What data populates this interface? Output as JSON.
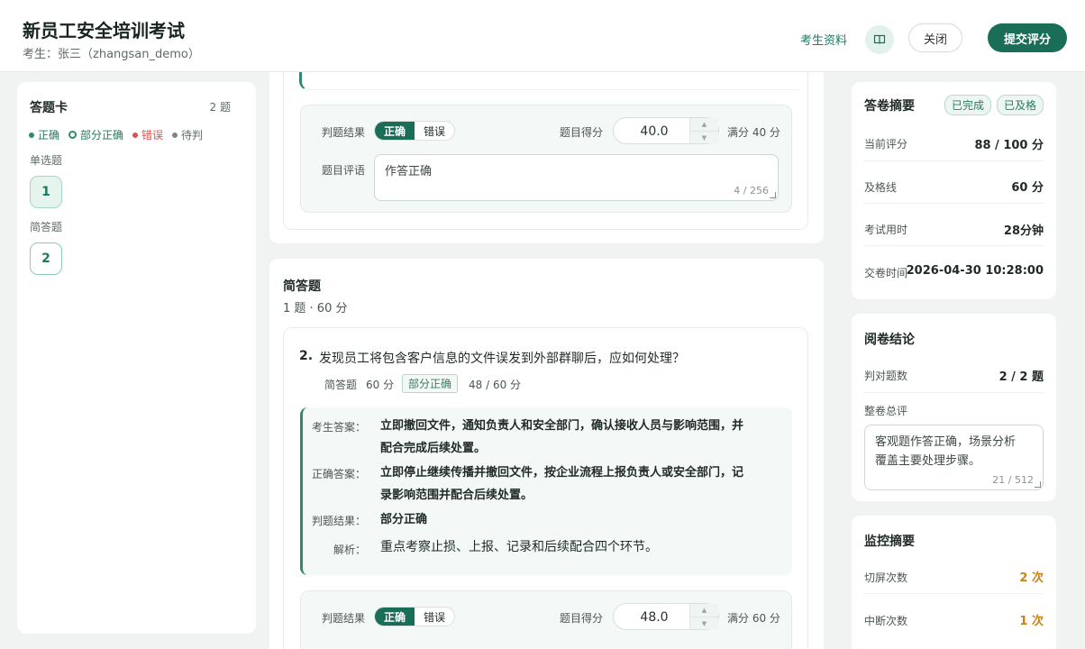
{
  "header": {
    "title": "新员工安全培训考试",
    "subtitle": "考生：张三（zhangsan_demo）",
    "profile_link": "考生资料",
    "close_label": "关闭",
    "submit_label": "提交评分"
  },
  "answer_card": {
    "title": "答题卡",
    "count": "2 题",
    "legend": {
      "correct": "正确",
      "partial": "部分正确",
      "wrong": "错误",
      "pending": "待判"
    },
    "sections": [
      {
        "label": "单选题",
        "questions": [
          "1"
        ]
      },
      {
        "label": "简答题",
        "questions": [
          "2"
        ]
      }
    ]
  },
  "q1_grading": {
    "result_label": "判题结果",
    "correct_label": "正确",
    "wrong_label": "错误",
    "score_label": "题目得分",
    "score_value": "40.0",
    "full_score": "满分 40 分",
    "comment_label": "题目评语",
    "comment": "作答正确",
    "comment_count": "4 / 256"
  },
  "section_short": {
    "title": "简答题",
    "summary": "1 题 · 60 分"
  },
  "q2": {
    "number": "2.",
    "text": "发现员工将包含客户信息的文件误发到外部群聊后，应如何处理？",
    "type": "简答题",
    "points": "60 分",
    "status_badge": "部分正确",
    "score": "48 / 60 分",
    "student_answer_label": "考生答案：",
    "student_answer_line1": "立即撤回文件，通知负责人和安全部门，确认接收人员与影响范围，并",
    "student_answer_line2": "配合完成后续处置。",
    "correct_answer_label": "正确答案：",
    "correct_answer_line1": "立即停止继续传播并撤回文件，按企业流程上报负责人或安全部门，记",
    "correct_answer_line2": "录影响范围并配合后续处置。",
    "result_label": "判题结果：",
    "result_value": "部分正确",
    "analysis_label": "解析：",
    "analysis": "重点考察止损、上报、记录和后续配合四个环节。"
  },
  "q2_grading": {
    "result_label": "判题结果",
    "correct_label": "正确",
    "wrong_label": "错误",
    "score_label": "题目得分",
    "score_value": "48.0",
    "full_score": "满分 60 分"
  },
  "summary": {
    "title": "答卷摘要",
    "badge_done": "已完成",
    "badge_pass": "已及格",
    "rows": [
      {
        "k": "当前评分",
        "v": "88 / 100 分"
      },
      {
        "k": "及格线",
        "v": "60 分"
      },
      {
        "k": "考试用时",
        "v": "28分钟"
      },
      {
        "k": "交卷时间",
        "v": "2026-04-30 10:28:00"
      }
    ]
  },
  "conclusion": {
    "title": "阅卷结论",
    "correct_k": "判对题数",
    "correct_v": "2 / 2 题",
    "overall_label": "整卷总评",
    "overall_line1": "客观题作答正确，场景分析",
    "overall_line2": "覆盖主要处理步骤。",
    "overall_count": "21 / 512"
  },
  "monitor": {
    "title": "监控摘要",
    "rows": [
      {
        "k": "切屏次数",
        "v": "2 次"
      },
      {
        "k": "中断次数",
        "v": "1 次"
      }
    ]
  },
  "colors": {
    "accent": "#1a6e58",
    "warning": "#c78318",
    "wrong": "#d9534f"
  }
}
